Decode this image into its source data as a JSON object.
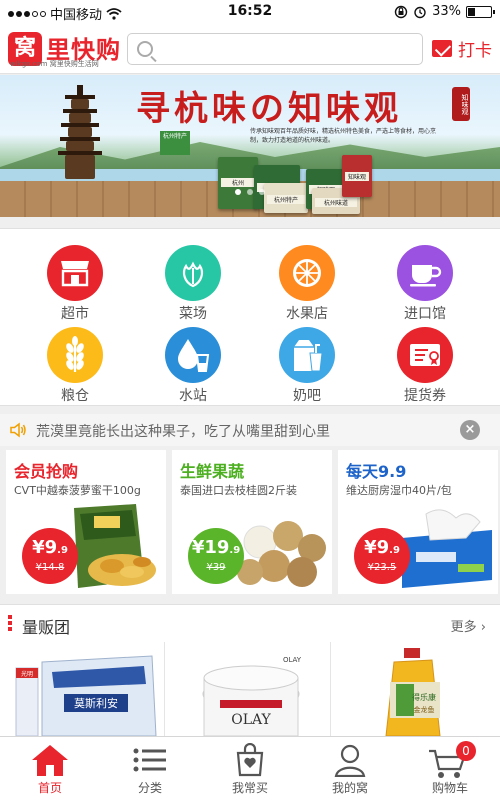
{
  "status_bar": {
    "carrier": "中国移动",
    "time": "16:52",
    "battery": "33%"
  },
  "header": {
    "logo_mark": "窝",
    "logo_name": "里快购",
    "logo_sub": "wlkgo.com 窝里快购生活网",
    "search_placeholder": "",
    "checkin_label": "打卡"
  },
  "banner": {
    "title": "寻杭味の知味观",
    "seal": "知味观",
    "badge": "杭州特产",
    "copy": "传承知味观百年品质好味，精选杭州特色美食，严选上等食材，用心烹制，致力打造地道的杭州味道。",
    "box_labels": [
      "杭州",
      "知味观",
      "杭州特产",
      "知味观",
      "杭州味道",
      "知味观"
    ],
    "page_count": 3,
    "active_page": 1
  },
  "categories": [
    {
      "name": "超市",
      "color": "#e8242c",
      "icon": "store-icon"
    },
    {
      "name": "菜场",
      "color": "#27c7a6",
      "icon": "vegetable-icon"
    },
    {
      "name": "水果店",
      "color": "#ff8a1f",
      "icon": "orange-slice-icon"
    },
    {
      "name": "进口馆",
      "color": "#9b52e0",
      "icon": "coffee-cup-icon"
    },
    {
      "name": "粮仓",
      "color": "#fdbb1a",
      "icon": "wheat-icon"
    },
    {
      "name": "水站",
      "color": "#2a8fd8",
      "icon": "water-drop-icon"
    },
    {
      "name": "奶吧",
      "color": "#3ea7e6",
      "icon": "milk-carton-icon"
    },
    {
      "name": "提货券",
      "color": "#e8242c",
      "icon": "voucher-icon"
    }
  ],
  "news": {
    "text": "荒漠里竟能长出这种果子，吃了从嘴里甜到心里"
  },
  "promos": [
    {
      "title": "会员抢购",
      "title_color": "#e8242c",
      "desc": "CVT中越泰菠萝蜜干100g",
      "price_int": "¥9",
      "price_dec": ".9",
      "old_price": "¥14.8",
      "badge_color": "#e8242c"
    },
    {
      "title": "生鲜果蔬",
      "title_color": "#4caf20",
      "desc": "泰国进口去枝桂圆2斤装",
      "price_int": "¥19",
      "price_dec": ".9",
      "old_price": "¥39",
      "badge_color": "#5bb52a"
    },
    {
      "title": "每天9.9",
      "title_color": "#1d63c9",
      "desc": "维达厨房湿巾40片/包",
      "price_int": "¥9",
      "price_dec": ".9",
      "old_price": "¥23.5",
      "badge_color": "#e8242c"
    }
  ],
  "section": {
    "title": "量贩团",
    "more": "更多"
  },
  "products": [
    {
      "name": "莫斯利安",
      "brand": "光明"
    },
    {
      "name": "OLAY",
      "brand": "OLAY"
    },
    {
      "name": "金龙鱼",
      "brand": "得乐康"
    }
  ],
  "tabbar": [
    {
      "label": "首页",
      "icon": "home-icon",
      "active": true
    },
    {
      "label": "分类",
      "icon": "list-icon",
      "active": false
    },
    {
      "label": "我常买",
      "icon": "shopping-bag-icon",
      "active": false
    },
    {
      "label": "我的窝",
      "icon": "user-icon",
      "active": false
    },
    {
      "label": "购物车",
      "icon": "cart-icon",
      "active": false,
      "badge": "0"
    }
  ],
  "colors": {
    "brand_red": "#e8242c"
  }
}
